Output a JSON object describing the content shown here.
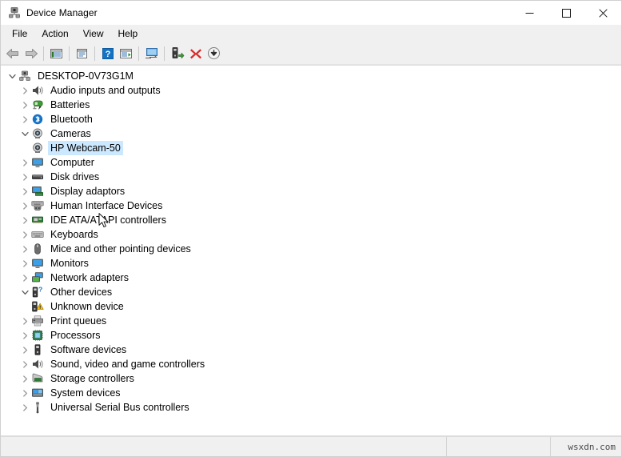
{
  "window": {
    "title": "Device Manager",
    "title_icon": "device-manager-icon",
    "controls": {
      "minimize": "minimize-button",
      "maximize": "maximize-button",
      "close": "close-button"
    }
  },
  "menubar": {
    "items": [
      {
        "label": "File"
      },
      {
        "label": "Action"
      },
      {
        "label": "View"
      },
      {
        "label": "Help"
      }
    ]
  },
  "toolbar": {
    "buttons": [
      {
        "name": "back-arrow-icon",
        "tip": "Back"
      },
      {
        "name": "forward-arrow-icon",
        "tip": "Forward"
      },
      {
        "name": "show-hide-console-tree-icon",
        "tip": "Show/Hide Console Tree"
      },
      {
        "name": "properties-icon",
        "tip": "Properties"
      },
      {
        "name": "help-icon",
        "tip": "Help"
      },
      {
        "name": "show-hide-action-pane-icon",
        "tip": "Show/Hide Action Pane"
      },
      {
        "name": "update-driver-icon",
        "tip": "Update Driver Software"
      },
      {
        "name": "scan-hardware-changes-icon",
        "tip": "Scan for hardware changes"
      },
      {
        "name": "uninstall-device-icon",
        "tip": "Uninstall device"
      },
      {
        "name": "disable-device-icon",
        "tip": "Disable device"
      }
    ]
  },
  "tree": {
    "nodes": [
      {
        "label": "DESKTOP-0V73G1M",
        "level": 0,
        "state": "expanded",
        "icon": "computer-root-icon",
        "selected": false
      },
      {
        "label": "Audio inputs and outputs",
        "level": 1,
        "state": "collapsed",
        "icon": "speaker-icon",
        "selected": false
      },
      {
        "label": "Batteries",
        "level": 1,
        "state": "collapsed",
        "icon": "battery-icon",
        "selected": false
      },
      {
        "label": "Bluetooth",
        "level": 1,
        "state": "collapsed",
        "icon": "bluetooth-icon",
        "selected": false
      },
      {
        "label": "Cameras",
        "level": 1,
        "state": "expanded",
        "icon": "camera-icon",
        "selected": false
      },
      {
        "label": "HP Webcam-50",
        "level": 2,
        "state": "leaf",
        "icon": "camera-icon",
        "selected": true
      },
      {
        "label": "Computer",
        "level": 1,
        "state": "collapsed",
        "icon": "monitor-icon",
        "selected": false
      },
      {
        "label": "Disk drives",
        "level": 1,
        "state": "collapsed",
        "icon": "disk-drive-icon",
        "selected": false
      },
      {
        "label": "Display adaptors",
        "level": 1,
        "state": "collapsed",
        "icon": "display-adapter-icon",
        "selected": false
      },
      {
        "label": "Human Interface Devices",
        "level": 1,
        "state": "collapsed",
        "icon": "hid-icon",
        "selected": false
      },
      {
        "label": "IDE ATA/ATAPI controllers",
        "level": 1,
        "state": "collapsed",
        "icon": "ide-controller-icon",
        "selected": false
      },
      {
        "label": "Keyboards",
        "level": 1,
        "state": "collapsed",
        "icon": "keyboard-icon",
        "selected": false
      },
      {
        "label": "Mice and other pointing devices",
        "level": 1,
        "state": "collapsed",
        "icon": "mouse-icon",
        "selected": false
      },
      {
        "label": "Monitors",
        "level": 1,
        "state": "collapsed",
        "icon": "monitor-icon",
        "selected": false
      },
      {
        "label": "Network adapters",
        "level": 1,
        "state": "collapsed",
        "icon": "network-adapter-icon",
        "selected": false
      },
      {
        "label": "Other devices",
        "level": 1,
        "state": "expanded",
        "icon": "unknown-device-question-icon",
        "selected": false
      },
      {
        "label": "Unknown device",
        "level": 2,
        "state": "leaf",
        "icon": "unknown-device-warning-icon",
        "selected": false
      },
      {
        "label": "Print queues",
        "level": 1,
        "state": "collapsed",
        "icon": "printer-icon",
        "selected": false
      },
      {
        "label": "Processors",
        "level": 1,
        "state": "collapsed",
        "icon": "processor-icon",
        "selected": false
      },
      {
        "label": "Software devices",
        "level": 1,
        "state": "collapsed",
        "icon": "software-device-icon",
        "selected": false
      },
      {
        "label": "Sound, video and game controllers",
        "level": 1,
        "state": "collapsed",
        "icon": "speaker-icon",
        "selected": false
      },
      {
        "label": "Storage controllers",
        "level": 1,
        "state": "collapsed",
        "icon": "storage-controller-icon",
        "selected": false
      },
      {
        "label": "System devices",
        "level": 1,
        "state": "collapsed",
        "icon": "system-device-icon",
        "selected": false
      },
      {
        "label": "Universal Serial Bus controllers",
        "level": 1,
        "state": "collapsed",
        "icon": "usb-icon",
        "selected": false
      }
    ]
  },
  "statusbar": {
    "panel1": "",
    "panel2": "",
    "watermark": "wsxdn.com"
  },
  "colors": {
    "selection": "#cce8ff",
    "window_bg": "#f0f0f0",
    "content_bg": "#ffffff",
    "accent_blue": "#1e90d6",
    "warning_yellow": "#ffc20e",
    "error_red": "#d92b2b",
    "green": "#3f9b35"
  }
}
